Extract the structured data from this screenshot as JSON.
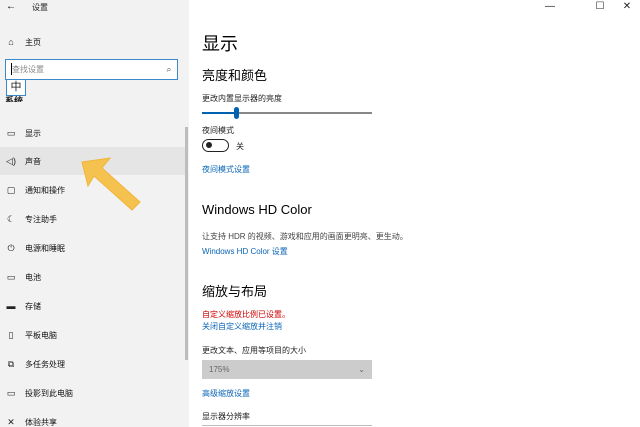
{
  "app": {
    "title": "设置",
    "back_icon": "back-arrow-icon"
  },
  "window_controls": {
    "minimize": "—",
    "maximize": "☐",
    "close": "✕"
  },
  "sidebar": {
    "home_label": "主页",
    "search_placeholder": "查找设置",
    "ime_indicator": "中",
    "section_label": "系统",
    "items": [
      {
        "label": "显示",
        "icon": "monitor-icon",
        "glyph": "▭"
      },
      {
        "label": "声音",
        "icon": "speaker-icon",
        "glyph": "🔈",
        "selected": true
      },
      {
        "label": "通知和操作",
        "icon": "notification-icon",
        "glyph": "▢"
      },
      {
        "label": "专注助手",
        "icon": "moon-icon",
        "glyph": "☾"
      },
      {
        "label": "电源和睡眠",
        "icon": "power-icon",
        "glyph": "⏻"
      },
      {
        "label": "电池",
        "icon": "battery-icon",
        "glyph": "▭"
      },
      {
        "label": "存储",
        "icon": "storage-icon",
        "glyph": "▬"
      },
      {
        "label": "平板电脑",
        "icon": "tablet-icon",
        "glyph": "▯"
      },
      {
        "label": "多任务处理",
        "icon": "multitask-icon",
        "glyph": "⧉"
      },
      {
        "label": "投影到此电脑",
        "icon": "project-icon",
        "glyph": "▭"
      },
      {
        "label": "体验共享",
        "icon": "share-icon",
        "glyph": "✕"
      }
    ]
  },
  "main": {
    "page_title": "显示",
    "brightness": {
      "heading": "亮度和颜色",
      "slider_label": "更改内置显示器的亮度",
      "slider_value": 0.2
    },
    "night_light": {
      "label": "夜间模式",
      "state": "关",
      "settings_link": "夜间模式设置"
    },
    "hdr": {
      "heading": "Windows HD Color",
      "description": "让支持 HDR 的视频、游戏和应用的画面更明亮、更生动。",
      "link": "Windows HD Color 设置"
    },
    "scale": {
      "heading": "缩放与布局",
      "custom_notice": "自定义缩放比例已设置。",
      "signout_link": "关闭自定义缩放并注销",
      "size_label": "更改文本、应用等项目的大小",
      "size_value": "175%",
      "advanced_link": "高级缩放设置",
      "resolution_label": "显示器分辨率"
    }
  },
  "colors": {
    "accent": "#0063b1",
    "link": "#0a64b6",
    "warning": "#d10000",
    "sidebar_bg": "#f2f2f2",
    "arrow": "#f5c14f"
  }
}
